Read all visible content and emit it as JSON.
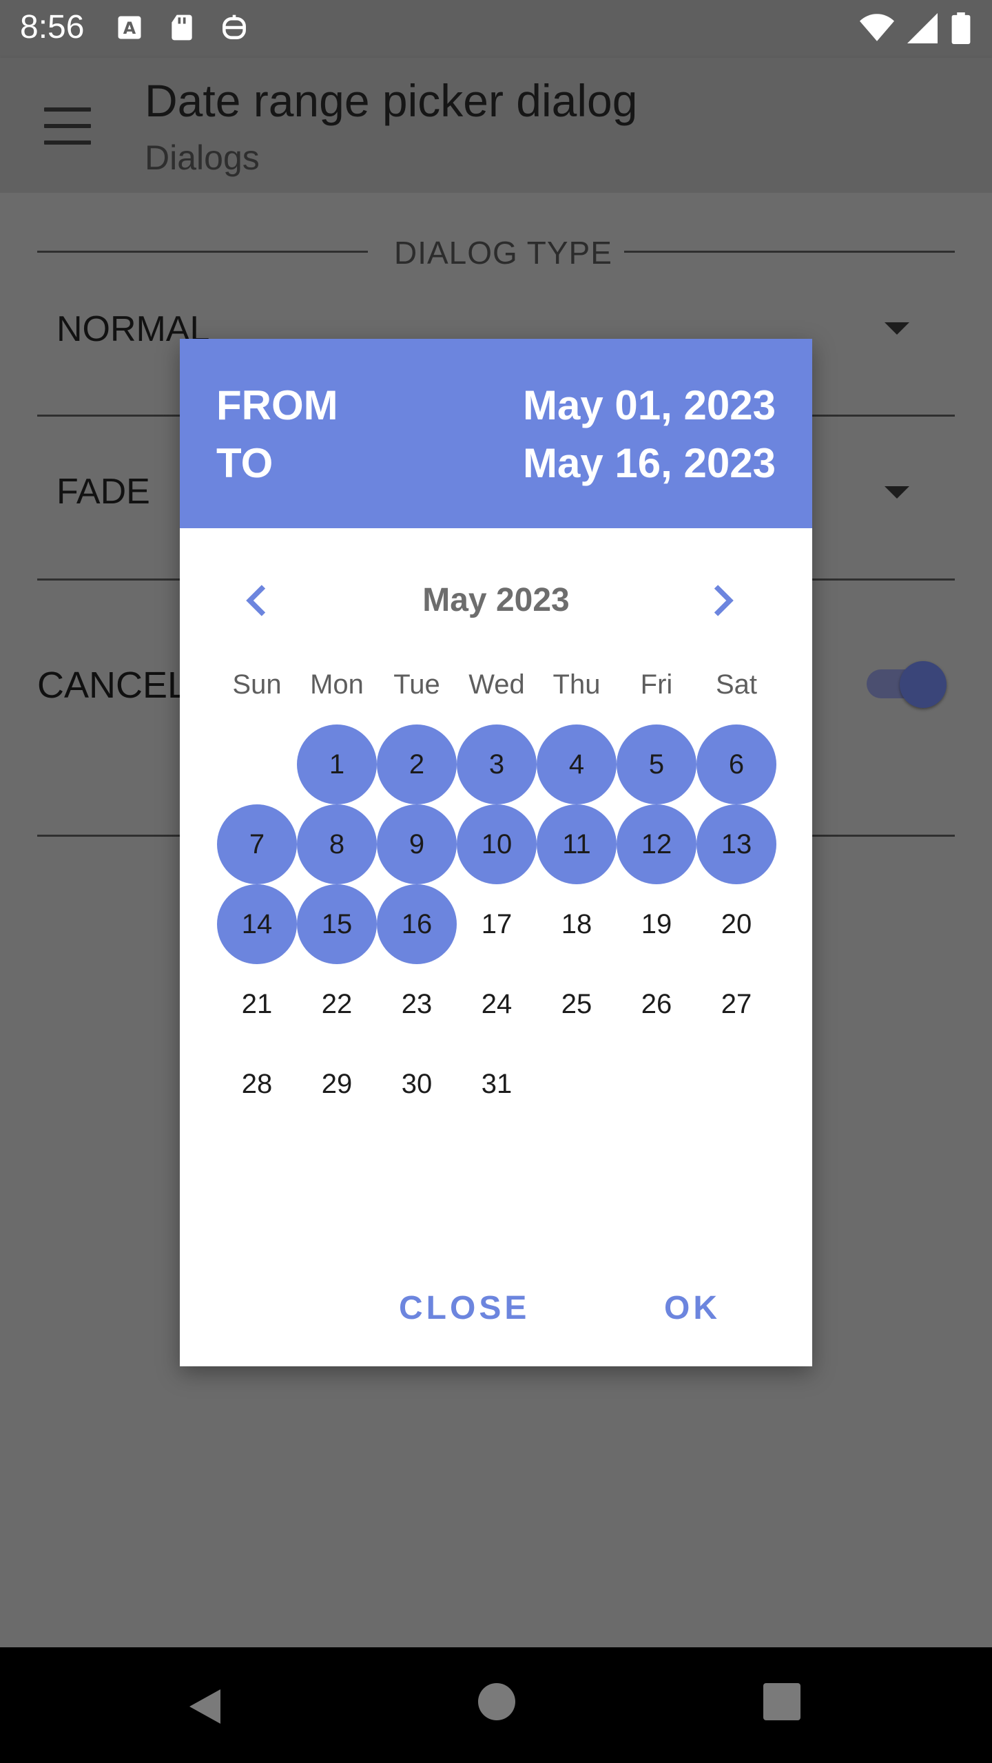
{
  "status_bar": {
    "time": "8:56"
  },
  "app_bar": {
    "title": "Date range picker dialog",
    "subtitle": "Dialogs"
  },
  "background": {
    "section_label": "DIALOG TYPE",
    "dialog_type_value": "NORMAL",
    "animation_value": "FADE",
    "cancel_label": "CANCEL",
    "cancelable_on": true
  },
  "dialog": {
    "header": {
      "from_label": "FROM",
      "to_label": "TO",
      "from_date": "May 01, 2023",
      "to_date": "May 16, 2023"
    },
    "month_label": "May 2023",
    "weekdays": [
      "Sun",
      "Mon",
      "Tue",
      "Wed",
      "Thu",
      "Fri",
      "Sat"
    ],
    "first_weekday_index": 1,
    "days_in_month": 31,
    "selected_range": [
      1,
      16
    ],
    "close_label": "CLOSE",
    "ok_label": "OK"
  },
  "colors": {
    "accent": "#6c85de",
    "scrim_background": "#6b6b6b",
    "switch_thumb": "#3a4579"
  }
}
